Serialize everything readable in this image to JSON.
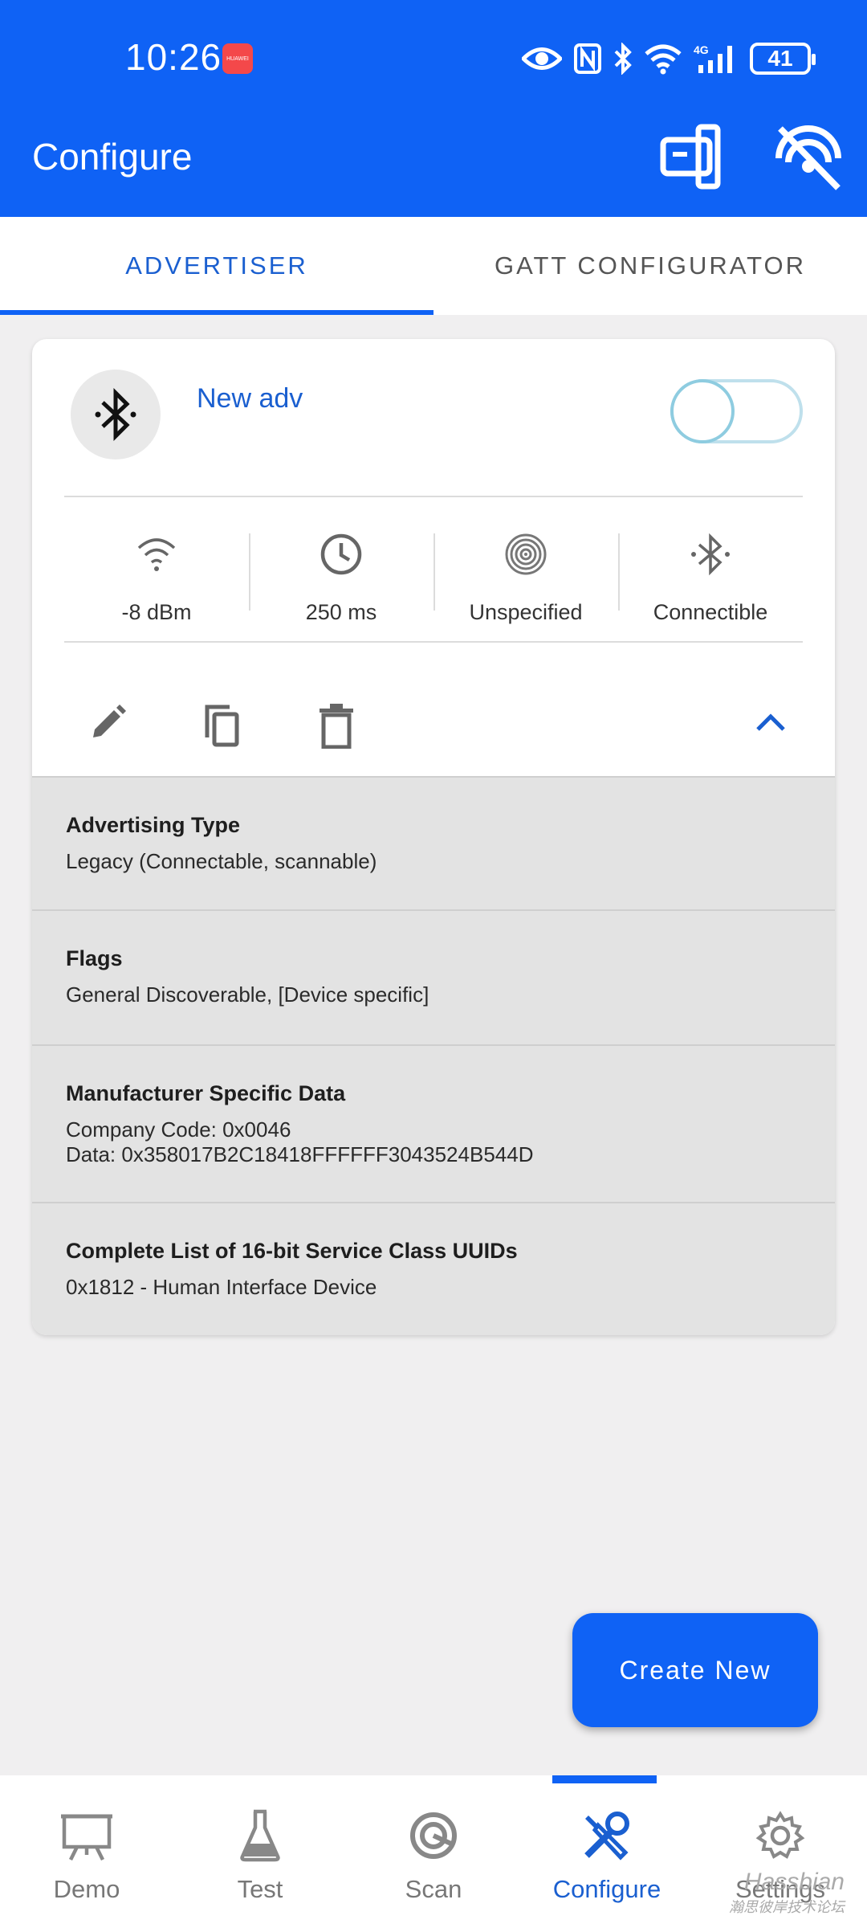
{
  "status_bar": {
    "time": "10:26",
    "battery": "41"
  },
  "header": {
    "title": "Configure"
  },
  "tabs": [
    {
      "label": "ADVERTISER",
      "active": true
    },
    {
      "label": "GATT CONFIGURATOR",
      "active": false
    }
  ],
  "advertiser": {
    "name": "New adv",
    "enabled": false,
    "stats": [
      {
        "icon": "wifi-signal-icon",
        "value": "-8 dBm"
      },
      {
        "icon": "clock-icon",
        "value": "250 ms"
      },
      {
        "icon": "fingerprint-icon",
        "value": "Unspecified"
      },
      {
        "icon": "bluetooth-icon",
        "value": "Connectible"
      }
    ],
    "details": [
      {
        "title": "Advertising Type",
        "lines": [
          "Legacy (Connectable, scannable)"
        ]
      },
      {
        "title": "Flags",
        "lines": [
          "General Discoverable, [Device specific]"
        ]
      },
      {
        "title": "Manufacturer Specific Data",
        "lines": [
          "Company Code: 0x0046",
          "Data: 0x358017B2C18418FFFFFF3043524B544D"
        ]
      },
      {
        "title": "Complete List of 16-bit Service Class UUIDs",
        "lines": [
          "0x1812 - Human Interface Device"
        ]
      }
    ]
  },
  "fab": {
    "label": "Create New"
  },
  "bottom_nav": [
    {
      "label": "Demo",
      "icon": "presentation-icon",
      "active": false
    },
    {
      "label": "Test",
      "icon": "flask-icon",
      "active": false
    },
    {
      "label": "Scan",
      "icon": "scan-target-icon",
      "active": false
    },
    {
      "label": "Configure",
      "icon": "tools-icon",
      "active": true
    },
    {
      "label": "Settings",
      "icon": "gear-icon",
      "active": false
    }
  ],
  "watermark": {
    "line1": "Hassbian",
    "line2": "瀚思彼岸技术论坛"
  },
  "colors": {
    "primary": "#0f62f5",
    "accent_text": "#1a5fd0",
    "detail_bg": "#e3e3e3"
  }
}
